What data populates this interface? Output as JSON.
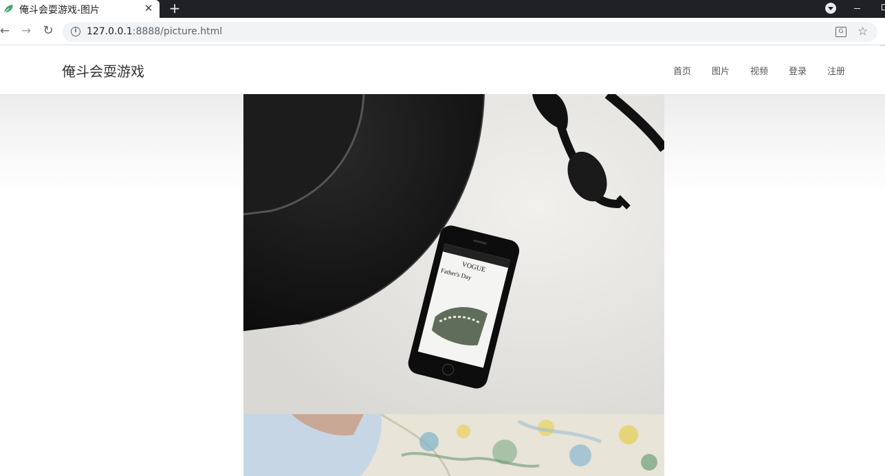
{
  "browser": {
    "tab_title": "俺斗会耍游戏-图片",
    "tab_close": "✕",
    "new_tab": "+",
    "url_host": "127.0.0.1",
    "url_rest": ":8888/picture.html",
    "icons": {
      "back": "arrow-left-icon",
      "forward": "arrow-right-icon",
      "reload": "reload-icon",
      "info": "info-icon",
      "translate": "translate-icon",
      "bookmark": "star-icon",
      "tab_search": "chevron-down-icon"
    }
  },
  "site": {
    "brand": "俺斗会耍游戏",
    "nav": [
      {
        "label": "首页"
      },
      {
        "label": "图片"
      },
      {
        "label": "视频"
      },
      {
        "label": "登录"
      },
      {
        "label": "注册"
      }
    ]
  },
  "photos": [
    {
      "subject": "black hat, sunglasses and smartphone on white table",
      "phone_text": "VOGUE",
      "phone_subtext": "Father's Day"
    },
    {
      "subject": "feet on floral bedding"
    }
  ],
  "colors": {
    "tab_strip": "#202124",
    "omnibox": "#f1f3f4",
    "brand_text": "#333333",
    "nav_text": "#555555"
  }
}
